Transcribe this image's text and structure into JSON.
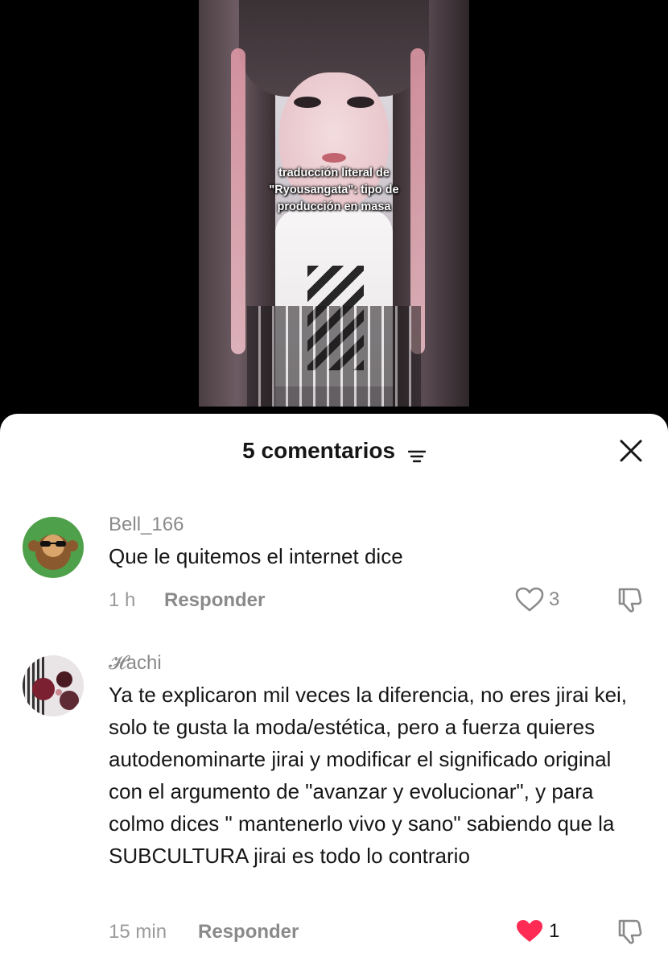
{
  "video": {
    "overlay_lines": [
      "traducción literal de",
      "\"Ryousangata\": tipo de",
      "producción en masa"
    ]
  },
  "comments_panel": {
    "title": "5 comentarios",
    "icons": {
      "filter": "filter-icon",
      "close": "close-icon"
    }
  },
  "comments": [
    {
      "username": "Bell_166",
      "text": "Que le quitemos el internet dice",
      "time": "1 h",
      "reply_label": "Responder",
      "likes": "3",
      "liked": false
    },
    {
      "username": "𝓗achi",
      "text": "Ya te explicaron mil veces la diferencia, no eres jirai kei, solo te gusta la moda/estética, pero a fuerza quieres autodenominarte jirai y modificar el significado original con el argumento de \"avanzar y evolucionar\", y para colmo dices \" mantenerlo vivo y sano\" sabiendo que la SUBCULTURA jirai es todo lo contrario",
      "time": "15 min",
      "reply_label": "Responder",
      "likes": "1",
      "liked": true
    }
  ],
  "colors": {
    "like_red": "#fe2c55",
    "text_gray": "#8a8a8a",
    "text_dark": "#161616"
  }
}
